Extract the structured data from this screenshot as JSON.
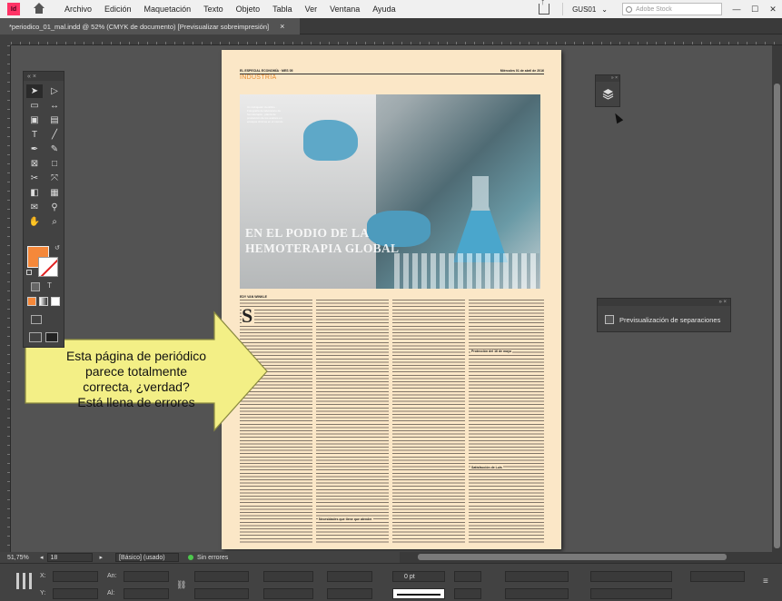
{
  "menubar": {
    "app_badge": "Id",
    "items": [
      "Archivo",
      "Edición",
      "Maquetación",
      "Texto",
      "Objeto",
      "Tabla",
      "Ver",
      "Ventana",
      "Ayuda"
    ],
    "workspace": "GUS01",
    "workspace_chevron": "⌄",
    "stock_placeholder": "Adobe Stock",
    "window_buttons": [
      "—",
      "☐",
      "✕"
    ]
  },
  "tab": {
    "title": "*periodico_01_mal.indd @ 52% (CMYK de documento) [Previsualizar sobreimpresión]",
    "close": "×"
  },
  "page": {
    "header_left": "EL ESPECIAL ECONOMÍA · MES 05",
    "header_right": "Miércoles 01 de abril de 2016",
    "section": "INDUSTRIA",
    "photo_caption": "Un trabajador científico · Fotografía de laboratorio de hemoterapia · planta de producción de los análisis en ensayos clínicos en el mundo",
    "title_line1": "EN EL PODIO DE LA",
    "title_line2": "HEMOTERAPIA GLOBAL",
    "byline": "EDY VAN WINKLE",
    "dropcap": "S",
    "subhead_1": "Necesidades que tiene que atender",
    "subhead_2": "Protección del 16 de mayo",
    "subhead_3": "Satisfacción de Luis"
  },
  "callout": {
    "line1": "Esta página de periódico",
    "line2": "parece totalmente",
    "line3": "correcta, ¿verdad?",
    "line4": "Está llena de errores"
  },
  "panels": {
    "separations_label": "Previsualización de separaciones",
    "panel_close": "» ×",
    "tools_close": "« ×"
  },
  "status": {
    "zoom": "51,75%",
    "page_number": "18",
    "style": "[Básico] (usado)",
    "preflight": "Sin errores"
  },
  "control": {
    "x_label": "X:",
    "y_label": "Y:",
    "w_label": "An:",
    "h_label": "Al:",
    "stroke_weight": "0 pt"
  },
  "colors": {
    "fill_swatch": "#f5883a",
    "section_accent": "#e68a2e",
    "callout_fill": "#f3ef86",
    "page_paper": "#fbe7c7"
  }
}
